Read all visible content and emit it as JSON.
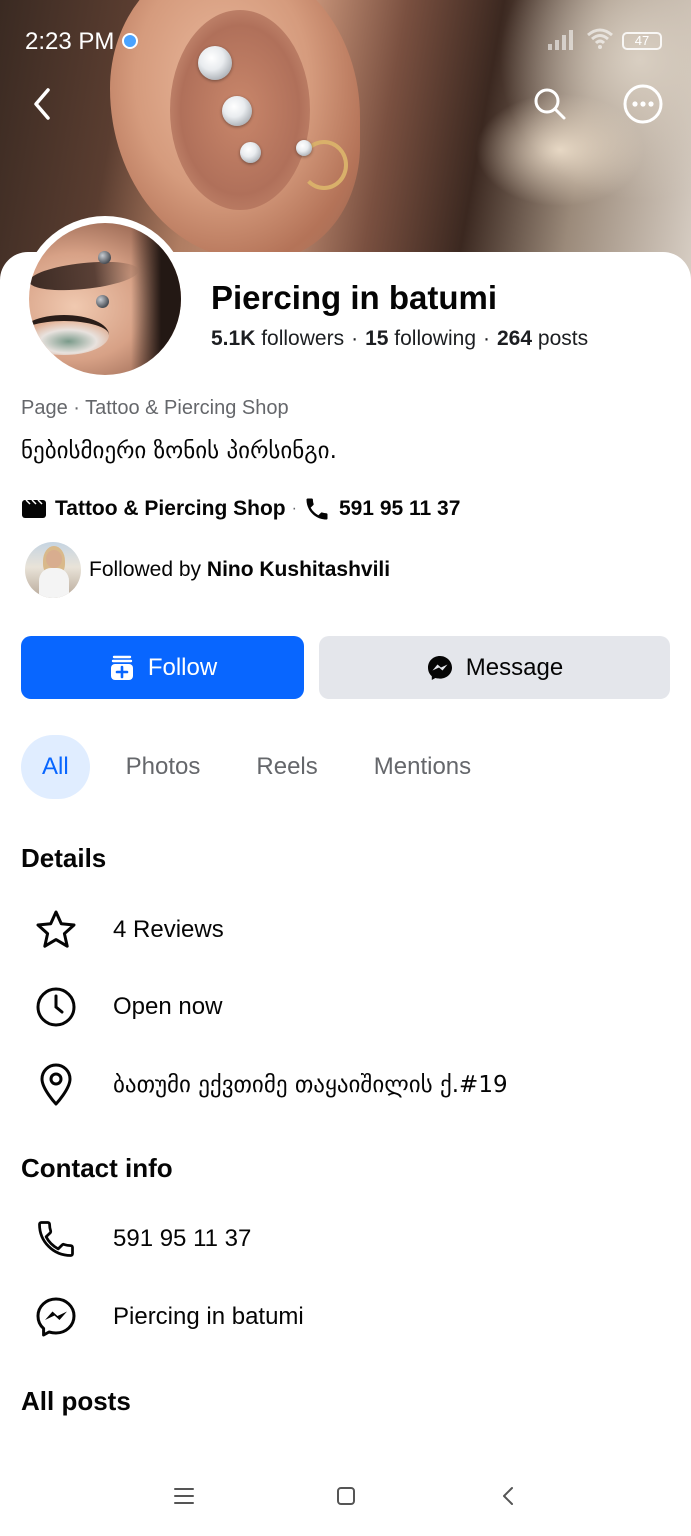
{
  "status_bar": {
    "time": "2:23 PM",
    "battery": "47"
  },
  "cover": {
    "alt": "ear piercings photo"
  },
  "page": {
    "name": "Piercing in batumi",
    "followers_count": "5.1K",
    "followers_label": "followers",
    "following_count": "15",
    "following_label": "following",
    "posts_count": "264",
    "posts_label": "posts",
    "category_line": "Page · Tattoo & Piercing Shop",
    "bio": "ნებისმიერი ზონის პირსინგი.",
    "category": "Tattoo & Piercing Shop",
    "phone": "591 95 11 37"
  },
  "followed_by": {
    "prefix": "Followed by",
    "name": "Nino Kushitashvili"
  },
  "actions": {
    "follow_label": "Follow",
    "message_label": "Message",
    "follow_color": "#0866ff"
  },
  "tabs": [
    {
      "label": "All",
      "active": true
    },
    {
      "label": "Photos",
      "active": false
    },
    {
      "label": "Reels",
      "active": false
    },
    {
      "label": "Mentions",
      "active": false
    }
  ],
  "details": {
    "title": "Details",
    "reviews": "4 Reviews",
    "hours": "Open now",
    "address": "ბათუმი ექვთიმე თაყაიშილის ქ.#19"
  },
  "contact": {
    "title": "Contact info",
    "phone": "591 95 11 37",
    "messenger": "Piercing in batumi"
  },
  "posts": {
    "title": "All posts"
  },
  "icons": [
    "back-icon",
    "search-icon",
    "more-icon",
    "page-icon",
    "phone-icon",
    "follow-icon",
    "messenger-icon",
    "star-icon",
    "clock-icon",
    "location-pin-icon",
    "menu-icon",
    "home-icon",
    "nav-back-icon"
  ]
}
